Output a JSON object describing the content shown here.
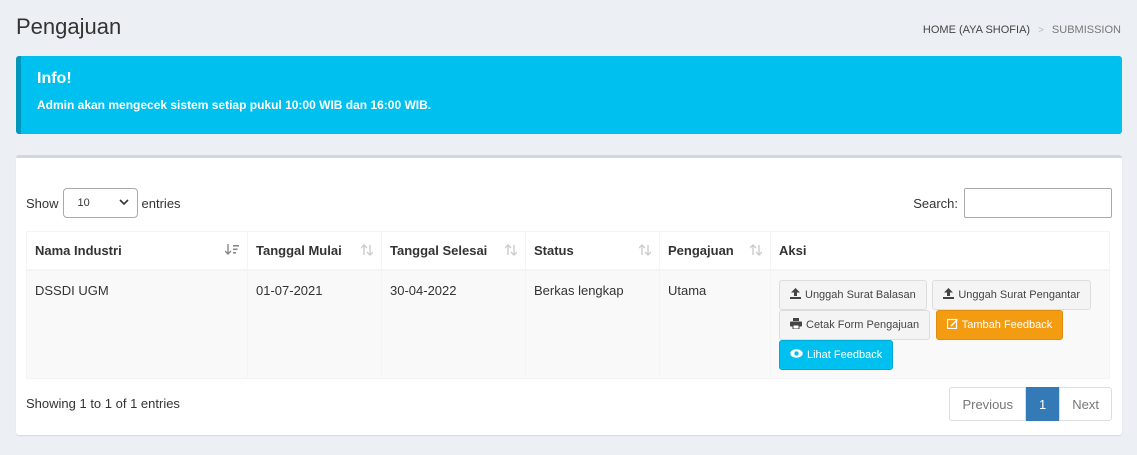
{
  "header": {
    "title": "Pengajuan"
  },
  "breadcrumb": {
    "home": "HOME (AYA SHOFIA)",
    "separator": ">",
    "current": "SUBMISSION"
  },
  "callout": {
    "title": "Info!",
    "message": "Admin akan mengecek sistem setiap pukul 10:00 WIB dan 16:00 WIB."
  },
  "table_controls": {
    "show_label": "Show",
    "entries_value": "10",
    "entries_label": "entries",
    "search_label": "Search:",
    "search_value": ""
  },
  "columns": [
    "Nama Industri",
    "Tanggal Mulai",
    "Tanggal Selesai",
    "Status",
    "Pengajuan",
    "Aksi"
  ],
  "rows": [
    {
      "nama_industri": "DSSDI UGM",
      "tanggal_mulai": "01-07-2021",
      "tanggal_selesai": "30-04-2022",
      "status": "Berkas lengkap",
      "pengajuan": "Utama",
      "actions": {
        "unggah_balasan": "Unggah Surat Balasan",
        "unggah_pengantar": "Unggah Surat Pengantar",
        "cetak_form": "Cetak Form Pengajuan",
        "tambah_feedback": "Tambah Feedback",
        "lihat_feedback": "Lihat Feedback"
      }
    }
  ],
  "footer": {
    "info": "Showing 1 to 1 of 1 entries",
    "previous": "Previous",
    "page": "1",
    "next": "Next"
  },
  "colors": {
    "info": "#00c0ef",
    "warning": "#f39c12",
    "primary": "#337ab7"
  }
}
